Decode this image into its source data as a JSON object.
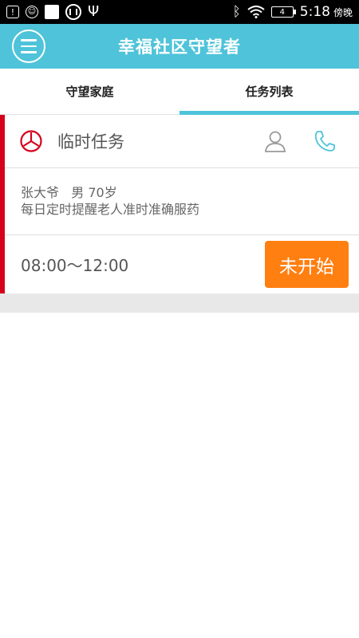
{
  "status_bar": {
    "battery_level": "4",
    "time": "5:18",
    "period": "傍晚"
  },
  "app_bar": {
    "title": "幸福社区守望者"
  },
  "tabs": [
    {
      "label": "守望家庭",
      "active": false
    },
    {
      "label": "任务列表",
      "active": true
    }
  ],
  "task": {
    "type": "临时任务",
    "person": "张大爷   男 70岁",
    "description": "每日定时提醒老人准时准确服药",
    "time_range": "08:00～12:00",
    "status": "未开始"
  },
  "colors": {
    "accent": "#4ec3d9",
    "task_marker": "#d5001b",
    "status_button": "#ff7f11"
  },
  "icons": [
    "menu-icon",
    "clock-icon",
    "person-icon",
    "phone-icon"
  ]
}
